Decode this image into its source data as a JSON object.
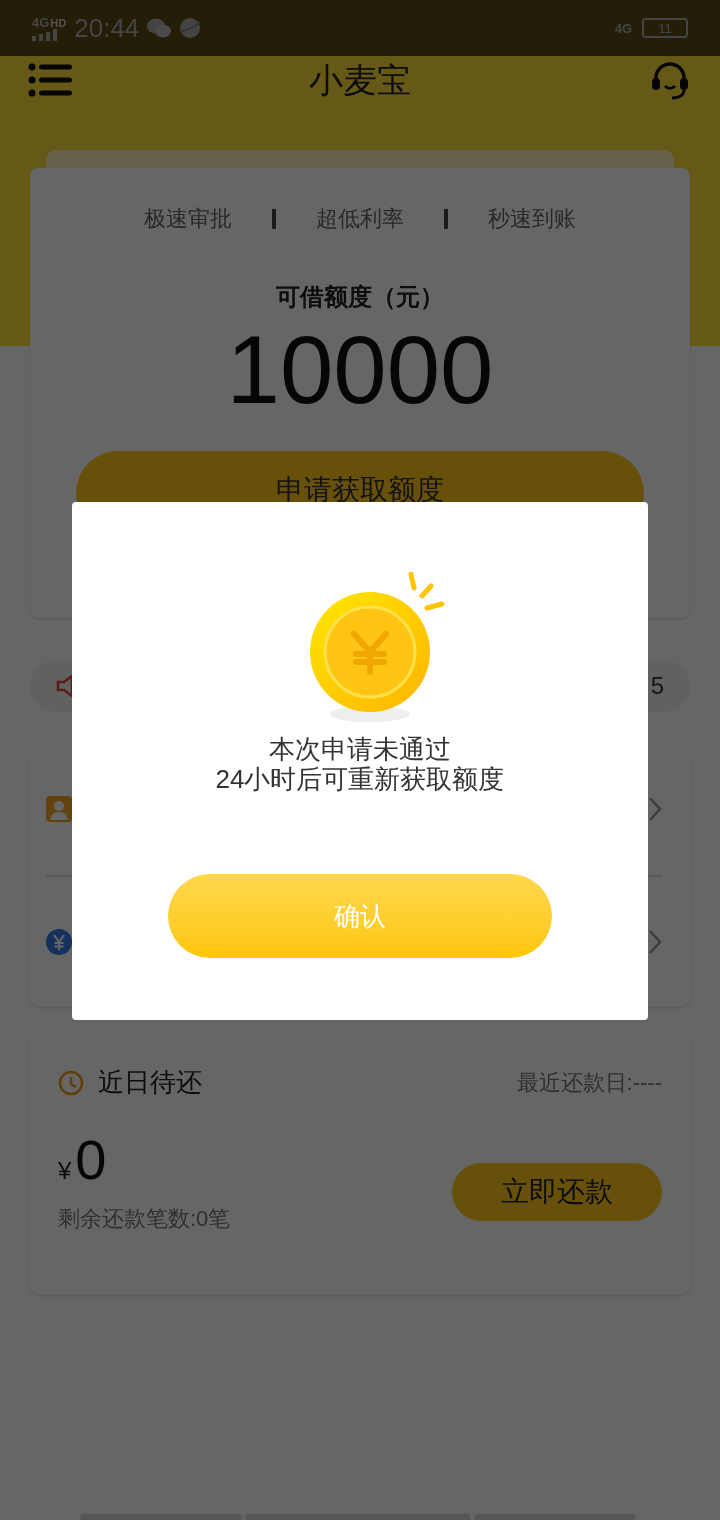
{
  "status_bar": {
    "network_left": "4G",
    "network_left_sup": "HD",
    "time": "20:44",
    "network_right": "4G",
    "battery": "11"
  },
  "header": {
    "title": "小麦宝"
  },
  "quota_card": {
    "features": [
      "极速审批",
      "超低利率",
      "秒速到账"
    ],
    "label": "可借额度（元）",
    "amount": "10000",
    "apply_button": "申请获取额度"
  },
  "notice": {
    "text_end": "5"
  },
  "menu_rows": [
    {
      "kind": "person"
    },
    {
      "kind": "yuan"
    }
  ],
  "repay_card": {
    "title": "近日待还",
    "due_date": "最近还款日:----",
    "currency": "¥",
    "amount": "0",
    "remaining": "剩余还款笔数:0笔",
    "button": "立即还款"
  },
  "dialog": {
    "open": true,
    "lines": [
      "本次申请未通过",
      "24小时后可重新获取额度"
    ],
    "button": "确认"
  }
}
